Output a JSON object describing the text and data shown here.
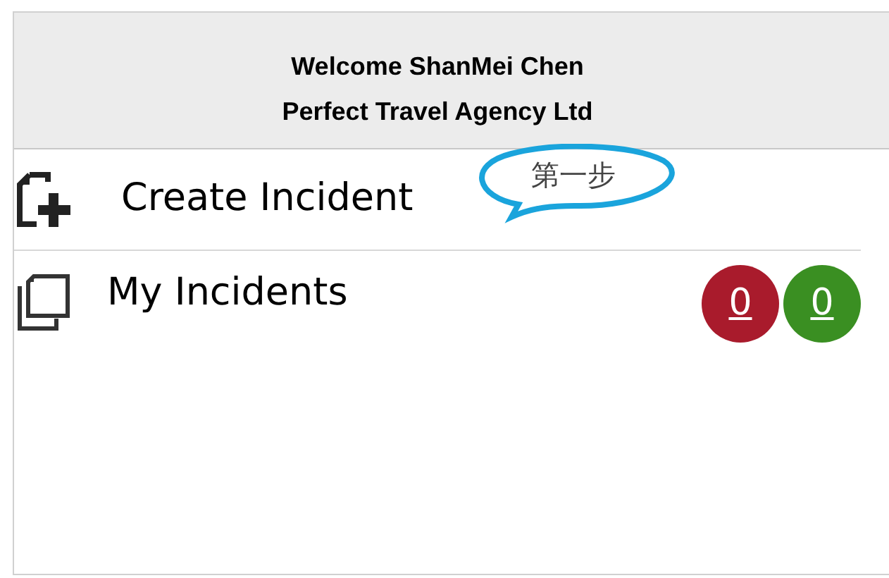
{
  "header": {
    "lines": [
      "Welcome ShanMei Chen",
      "Perfect Travel Agency Ltd"
    ]
  },
  "menu": [
    {
      "label": "Create Incident",
      "kind": "create",
      "callout": "第一步"
    },
    {
      "label": "My Incidents",
      "kind": "list",
      "badges": [
        {
          "text": "0",
          "color": "#a91b2c"
        },
        {
          "text": "0",
          "color": "#3a8f22"
        }
      ]
    }
  ]
}
